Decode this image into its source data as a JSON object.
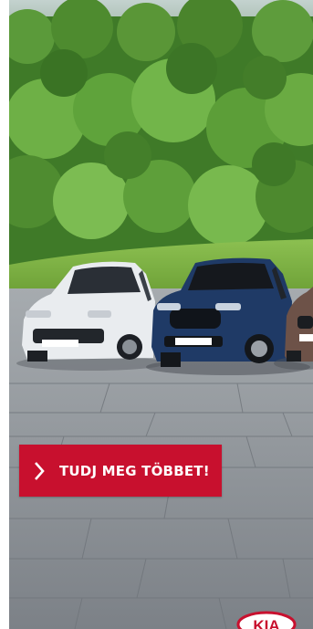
{
  "ad": {
    "cta_label": "TUDJ MEG TÖBBET!",
    "cta_icon": "chevron-right-icon",
    "brand": "KIA",
    "colors": {
      "cta_background": "#c8102e",
      "cta_text": "#ffffff",
      "sky": "#c9d4cf",
      "forest": "#4f8b2f",
      "lawn": "#7fb343",
      "pavement": "#8e949a"
    }
  },
  "cars": [
    {
      "name": "white-hatchback",
      "plate_text": "CEED PLUG-IN"
    },
    {
      "name": "blue-suv",
      "plate_text": "SPORTAGE PLUG-IN"
    },
    {
      "name": "brown-suv",
      "plate_text": ""
    }
  ]
}
